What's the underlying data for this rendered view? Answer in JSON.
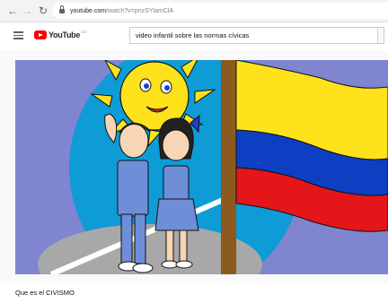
{
  "browser": {
    "url_host": "youtube.com",
    "url_path": "/watch?v=pnzSYlamClA"
  },
  "youtube": {
    "logo": "YouTube",
    "logo_country": "CO",
    "search_query": "video infantil sobre las normas cívicas"
  },
  "video": {
    "title": "Que es el CIVISMO",
    "flag_colors": [
      "#fde21c",
      "#0e3fc3",
      "#e4161a"
    ]
  },
  "icons": [
    "back-arrow-icon",
    "forward-arrow-icon",
    "reload-icon",
    "lock-icon",
    "menu-icon",
    "youtube-play-icon"
  ]
}
